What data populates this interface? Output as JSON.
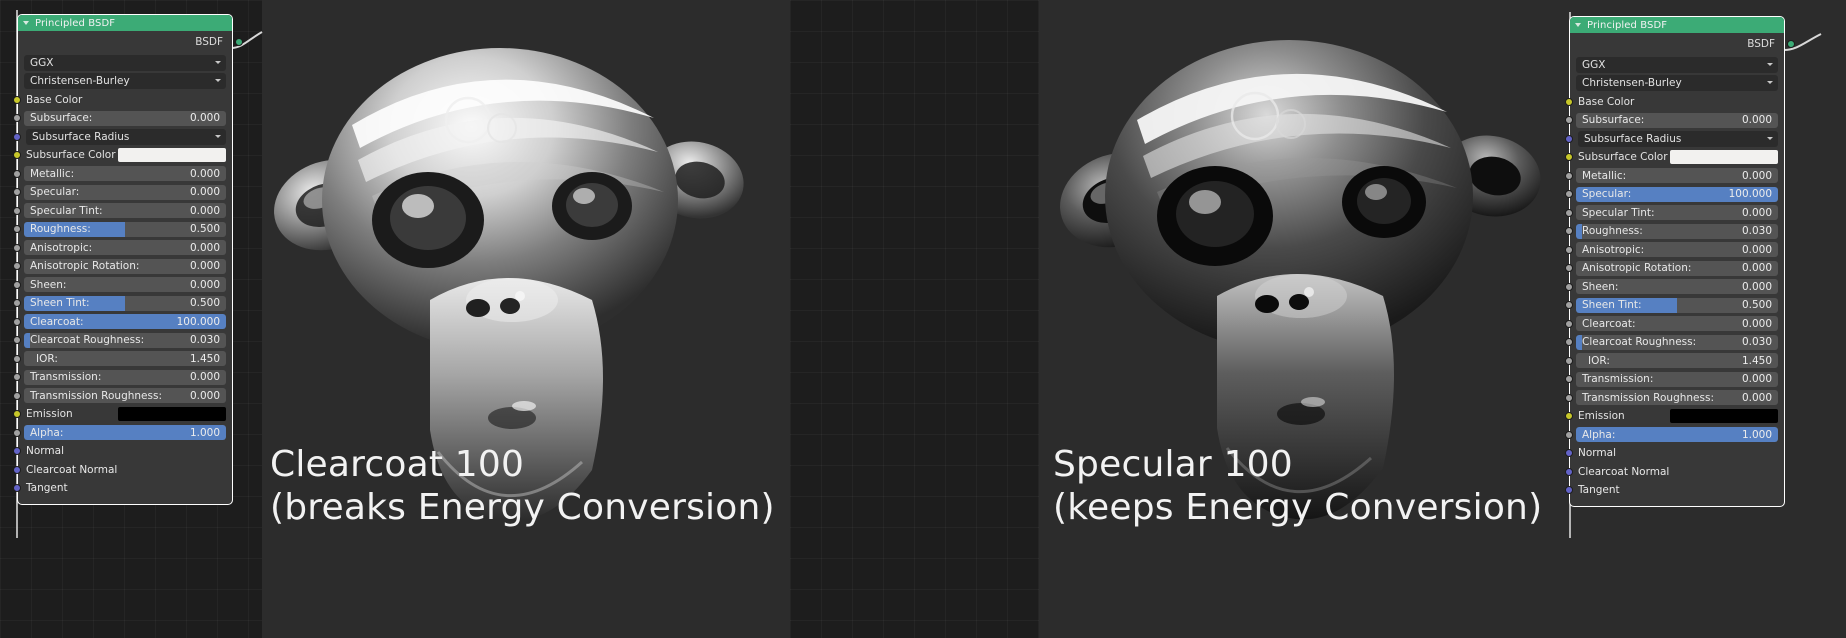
{
  "app": {
    "editor_name": "blender-shader-node-editor",
    "colors": {
      "node_header": "#3cab76",
      "slider_fill": "#5680c2",
      "node_body": "#383838",
      "field": "#545454",
      "editor_bg": "#1d1d1d",
      "render_bg": "#2c2c2c",
      "socket_yellow": "#c7c729",
      "socket_grey": "#a1a1a1",
      "socket_purple": "#6363c7",
      "socket_green": "#3cab76"
    }
  },
  "left": {
    "node": {
      "title": "Principled BSDF",
      "output_label": "BSDF",
      "distribution": "GGX",
      "subsurface_method": "Christensen-Burley",
      "rows": [
        {
          "label": "Base Color",
          "value": "",
          "socket": "yellow",
          "widget": "color",
          "swatch": "none",
          "fill": 0
        },
        {
          "label": "Subsurface:",
          "value": "0.000",
          "socket": "grey",
          "widget": "slider",
          "swatch": "none",
          "fill": 0
        },
        {
          "label": "Subsurface Radius",
          "value": "",
          "socket": "purple",
          "widget": "dropdown",
          "swatch": "none",
          "fill": 0
        },
        {
          "label": "Subsurface Color",
          "value": "",
          "socket": "yellow",
          "widget": "color",
          "swatch": "white",
          "fill": 0
        },
        {
          "label": "Metallic:",
          "value": "0.000",
          "socket": "grey",
          "widget": "slider",
          "swatch": "none",
          "fill": 0
        },
        {
          "label": "Specular:",
          "value": "0.000",
          "socket": "grey",
          "widget": "slider",
          "swatch": "none",
          "fill": 0
        },
        {
          "label": "Specular Tint:",
          "value": "0.000",
          "socket": "grey",
          "widget": "slider",
          "swatch": "none",
          "fill": 0
        },
        {
          "label": "Roughness:",
          "value": "0.500",
          "socket": "grey",
          "widget": "slider",
          "swatch": "none",
          "fill": 50
        },
        {
          "label": "Anisotropic:",
          "value": "0.000",
          "socket": "grey",
          "widget": "slider",
          "swatch": "none",
          "fill": 0
        },
        {
          "label": "Anisotropic Rotation:",
          "value": "0.000",
          "socket": "grey",
          "widget": "slider",
          "swatch": "none",
          "fill": 0
        },
        {
          "label": "Sheen:",
          "value": "0.000",
          "socket": "grey",
          "widget": "slider",
          "swatch": "none",
          "fill": 0
        },
        {
          "label": "Sheen Tint:",
          "value": "0.500",
          "socket": "grey",
          "widget": "slider",
          "swatch": "none",
          "fill": 50
        },
        {
          "label": "Clearcoat:",
          "value": "100.000",
          "socket": "grey",
          "widget": "slider",
          "swatch": "none",
          "fill": 100
        },
        {
          "label": "Clearcoat Roughness:",
          "value": "0.030",
          "socket": "grey",
          "widget": "slider",
          "swatch": "none",
          "fill": 3
        },
        {
          "label": "IOR:",
          "value": "1.450",
          "socket": "grey",
          "widget": "slider",
          "swatch": "none",
          "fill": 0,
          "indent": true
        },
        {
          "label": "Transmission:",
          "value": "0.000",
          "socket": "grey",
          "widget": "slider",
          "swatch": "none",
          "fill": 0
        },
        {
          "label": "Transmission Roughness:",
          "value": "0.000",
          "socket": "grey",
          "widget": "slider",
          "swatch": "none",
          "fill": 0
        },
        {
          "label": "Emission",
          "value": "",
          "socket": "yellow",
          "widget": "color",
          "swatch": "black",
          "fill": 0
        },
        {
          "label": "Alpha:",
          "value": "1.000",
          "socket": "grey",
          "widget": "slider",
          "swatch": "none",
          "fill": 100
        },
        {
          "label": "Normal",
          "value": "",
          "socket": "purple",
          "widget": "text",
          "swatch": "none",
          "fill": 0
        },
        {
          "label": "Clearcoat Normal",
          "value": "",
          "socket": "purple",
          "widget": "text",
          "swatch": "none",
          "fill": 0
        },
        {
          "label": "Tangent",
          "value": "",
          "socket": "purple",
          "widget": "text",
          "swatch": "none",
          "fill": 0
        }
      ]
    },
    "caption_line1": "Clearcoat 100",
    "caption_line2": "(breaks Energy Conversion)"
  },
  "right": {
    "node": {
      "title": "Principled BSDF",
      "output_label": "BSDF",
      "distribution": "GGX",
      "subsurface_method": "Christensen-Burley",
      "rows": [
        {
          "label": "Base Color",
          "value": "",
          "socket": "yellow",
          "widget": "color",
          "swatch": "none",
          "fill": 0
        },
        {
          "label": "Subsurface:",
          "value": "0.000",
          "socket": "grey",
          "widget": "slider",
          "swatch": "none",
          "fill": 0
        },
        {
          "label": "Subsurface Radius",
          "value": "",
          "socket": "purple",
          "widget": "dropdown",
          "swatch": "none",
          "fill": 0
        },
        {
          "label": "Subsurface Color",
          "value": "",
          "socket": "yellow",
          "widget": "color",
          "swatch": "white",
          "fill": 0
        },
        {
          "label": "Metallic:",
          "value": "0.000",
          "socket": "grey",
          "widget": "slider",
          "swatch": "none",
          "fill": 0
        },
        {
          "label": "Specular:",
          "value": "100.000",
          "socket": "grey",
          "widget": "slider",
          "swatch": "none",
          "fill": 100
        },
        {
          "label": "Specular Tint:",
          "value": "0.000",
          "socket": "grey",
          "widget": "slider",
          "swatch": "none",
          "fill": 0
        },
        {
          "label": "Roughness:",
          "value": "0.030",
          "socket": "grey",
          "widget": "slider",
          "swatch": "none",
          "fill": 3
        },
        {
          "label": "Anisotropic:",
          "value": "0.000",
          "socket": "grey",
          "widget": "slider",
          "swatch": "none",
          "fill": 0
        },
        {
          "label": "Anisotropic Rotation:",
          "value": "0.000",
          "socket": "grey",
          "widget": "slider",
          "swatch": "none",
          "fill": 0
        },
        {
          "label": "Sheen:",
          "value": "0.000",
          "socket": "grey",
          "widget": "slider",
          "swatch": "none",
          "fill": 0
        },
        {
          "label": "Sheen Tint:",
          "value": "0.500",
          "socket": "grey",
          "widget": "slider",
          "swatch": "none",
          "fill": 50
        },
        {
          "label": "Clearcoat:",
          "value": "0.000",
          "socket": "grey",
          "widget": "slider",
          "swatch": "none",
          "fill": 0
        },
        {
          "label": "Clearcoat Roughness:",
          "value": "0.030",
          "socket": "grey",
          "widget": "slider",
          "swatch": "none",
          "fill": 3
        },
        {
          "label": "IOR:",
          "value": "1.450",
          "socket": "grey",
          "widget": "slider",
          "swatch": "none",
          "fill": 0,
          "indent": true
        },
        {
          "label": "Transmission:",
          "value": "0.000",
          "socket": "grey",
          "widget": "slider",
          "swatch": "none",
          "fill": 0
        },
        {
          "label": "Transmission Roughness:",
          "value": "0.000",
          "socket": "grey",
          "widget": "slider",
          "swatch": "none",
          "fill": 0
        },
        {
          "label": "Emission",
          "value": "",
          "socket": "yellow",
          "widget": "color",
          "swatch": "black",
          "fill": 0
        },
        {
          "label": "Alpha:",
          "value": "1.000",
          "socket": "grey",
          "widget": "slider",
          "swatch": "none",
          "fill": 100
        },
        {
          "label": "Normal",
          "value": "",
          "socket": "purple",
          "widget": "text",
          "swatch": "none",
          "fill": 0
        },
        {
          "label": "Clearcoat Normal",
          "value": "",
          "socket": "purple",
          "widget": "text",
          "swatch": "none",
          "fill": 0
        },
        {
          "label": "Tangent",
          "value": "",
          "socket": "purple",
          "widget": "text",
          "swatch": "none",
          "fill": 0
        }
      ]
    },
    "caption_line1": "Specular 100",
    "caption_line2": "(keeps Energy Conversion)"
  }
}
